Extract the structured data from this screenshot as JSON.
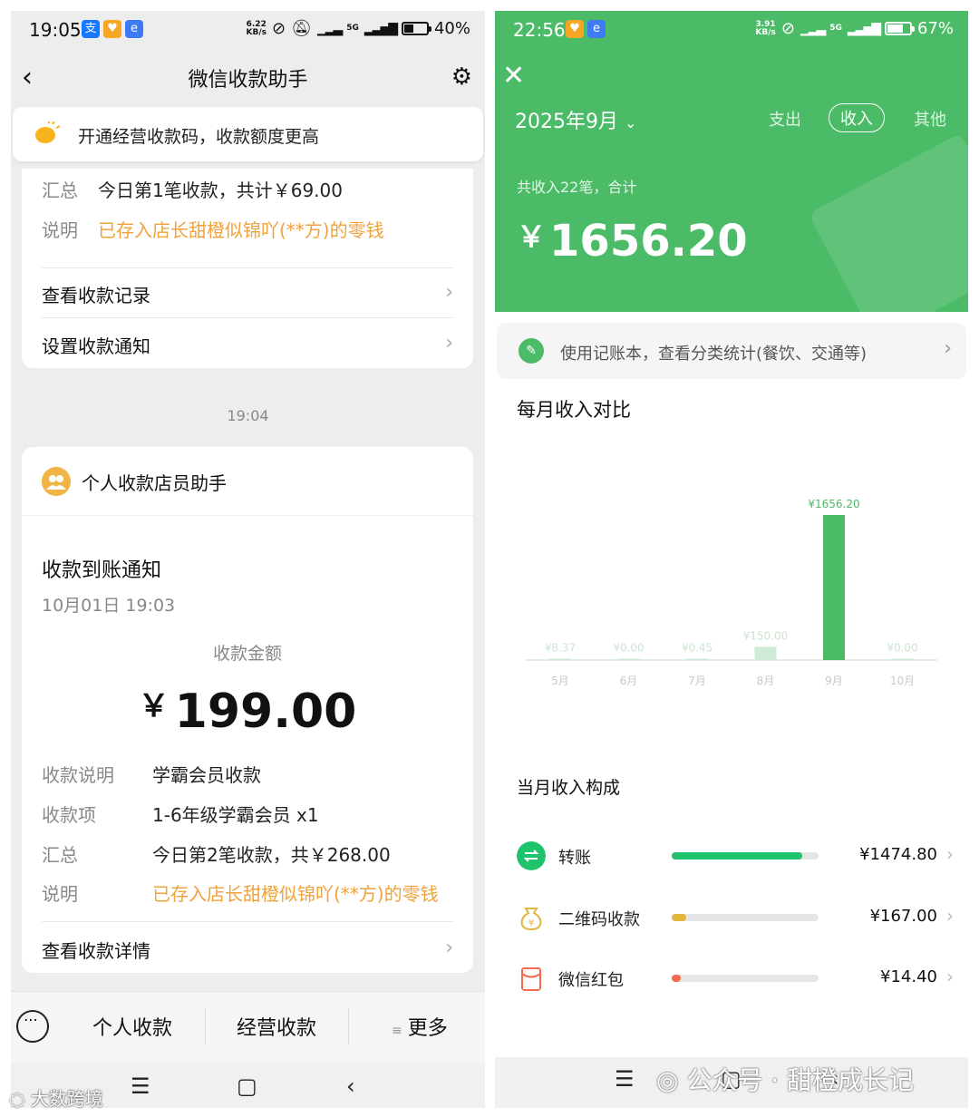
{
  "left": {
    "status": {
      "time": "19:05",
      "speed_top": "6.22",
      "speed_bottom": "KB/s",
      "net": "5G",
      "battery": "40%"
    },
    "nav": {
      "title": "微信收款助手"
    },
    "banner": {
      "text": "开通经营收款码，收款额度更高"
    },
    "card1": {
      "rows": [
        {
          "key": "汇总",
          "value": "今日第1笔收款，共计￥69.00"
        },
        {
          "key": "说明",
          "value": "已存入店长甜橙似锦吖(**方)的零钱"
        }
      ],
      "links": [
        "查看收款记录",
        "设置收款通知"
      ]
    },
    "timestamp": "19:04",
    "card2": {
      "title": "个人收款店员助手",
      "notice": "收款到账通知",
      "date": "10月01日 19:03",
      "amount_label": "收款金额",
      "currency": "￥",
      "amount": "199.00",
      "rows": [
        {
          "key": "收款说明",
          "value": "学霸会员收款"
        },
        {
          "key": "收款项",
          "value": "1-6年级学霸会员 x1"
        },
        {
          "key": "汇总",
          "value": "今日第2笔收款，共￥268.00"
        },
        {
          "key": "说明",
          "value": "已存入店长甜橙似锦吖(**方)的零钱"
        }
      ],
      "detail_link": "查看收款详情"
    },
    "bottom_menu": [
      "个人收款",
      "经营收款",
      "更多"
    ],
    "watermark": "大数跨境"
  },
  "right": {
    "status": {
      "time": "22:56",
      "speed_top": "3.91",
      "speed_bottom": "KB/s",
      "net": "5G",
      "battery": "67%"
    },
    "month": "2025年9月",
    "tabs": [
      "支出",
      "收入",
      "其他"
    ],
    "summary": "共收入22笔，合计",
    "currency": "￥",
    "total": "1656.20",
    "book_tip": "使用记账本，查看分类统计(餐饮、交通等)",
    "section_monthly": "每月收入对比",
    "section_composition": "当月收入构成",
    "composition": [
      {
        "label": "转账",
        "value": "¥1474.80",
        "share": 0.89,
        "color": "#1ec36b",
        "icon": "transfer-icon"
      },
      {
        "label": "二维码收款",
        "value": "¥167.00",
        "share": 0.1,
        "color": "#e2b53d",
        "icon": "qr-money-bag-icon"
      },
      {
        "label": "微信红包",
        "value": "¥14.40",
        "share": 0.01,
        "color": "#f26a4f",
        "icon": "red-packet-icon"
      }
    ],
    "watermark": "公众号 · 甜橙成长记"
  },
  "chart_data": {
    "type": "bar",
    "categories": [
      "5月",
      "6月",
      "7月",
      "8月",
      "9月",
      "10月"
    ],
    "values": [
      8.37,
      0.0,
      0.45,
      150.0,
      1656.2,
      0.0
    ],
    "labels": [
      "¥8.37",
      "¥0.00",
      "¥0.45",
      "¥150.00",
      "¥1656.20",
      "¥0.00"
    ],
    "highlight_index": 4,
    "colors": {
      "normal": "#cdebd6",
      "highlight": "#4cbb68"
    }
  }
}
